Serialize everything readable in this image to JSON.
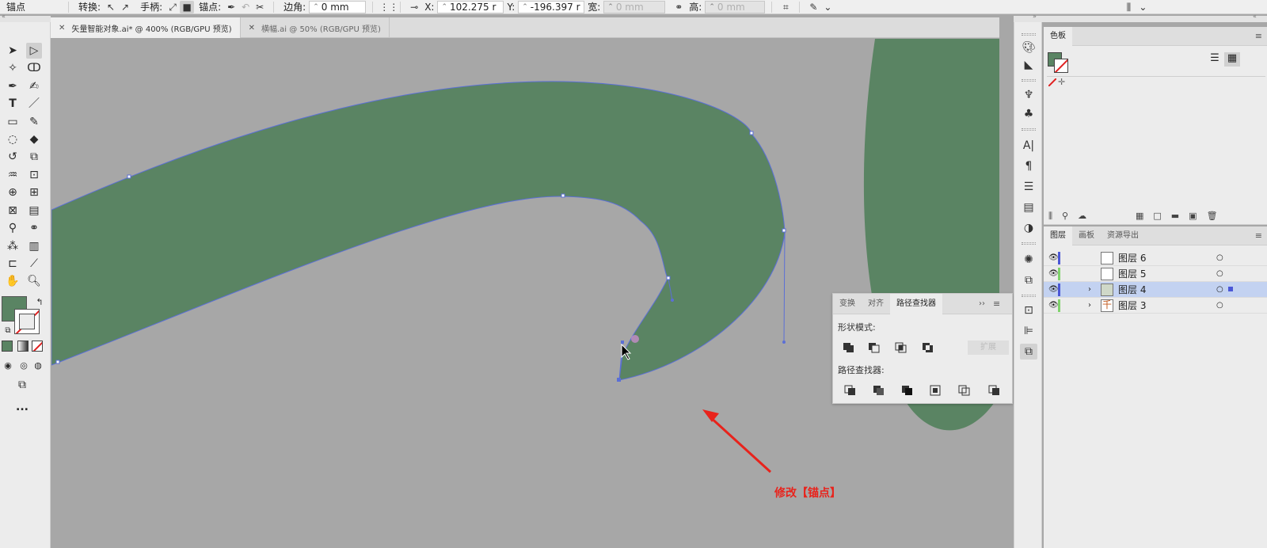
{
  "control_bar": {
    "selection_label": "锚点",
    "convert_label": "转换:",
    "handles_label": "手柄:",
    "anchors_label": "锚点:",
    "corner_label": "边角:",
    "corner_value": "0 mm",
    "x_label": "X:",
    "x_value": "102.275 r",
    "y_label": "Y:",
    "y_value": "-196.397 r",
    "w_label": "宽:",
    "w_value": "0 mm",
    "h_label": "高:",
    "h_value": "0 mm"
  },
  "document_tabs": [
    {
      "label": "矢量智能对象.ai* @ 400% (RGB/GPU 预览)",
      "active": true
    },
    {
      "label": "横幅.ai @ 50% (RGB/GPU 预览)",
      "active": false
    }
  ],
  "colors": {
    "shape_fill": "#5a8463",
    "path_stroke": "#5b6fd6",
    "canvas": "#a7a7a7",
    "annotation": "#e8231c",
    "layer_selected": "#c3d2f1"
  },
  "swatches_panel": {
    "title": "色板"
  },
  "layers_panel": {
    "tabs": [
      "图层",
      "画板",
      "资源导出"
    ],
    "layers": [
      {
        "name": "图层 6",
        "color": "#4b57d6",
        "selected": false,
        "expandable": false
      },
      {
        "name": "图层 5",
        "color": "#7fd26b",
        "selected": false,
        "expandable": false
      },
      {
        "name": "图层 4",
        "color": "#4b57d6",
        "selected": true,
        "expandable": true
      },
      {
        "name": "图层 3",
        "color": "#7fd26b",
        "selected": false,
        "expandable": true
      }
    ]
  },
  "pathfinder_panel": {
    "tabs": [
      "变换",
      "对齐",
      "路径查找器"
    ],
    "shape_modes_label": "形状模式:",
    "pathfinders_label": "路径查找器:",
    "expand_label": "扩展"
  },
  "annotation_text": "修改【锚点】",
  "toolbar": {
    "more_label": "..."
  }
}
